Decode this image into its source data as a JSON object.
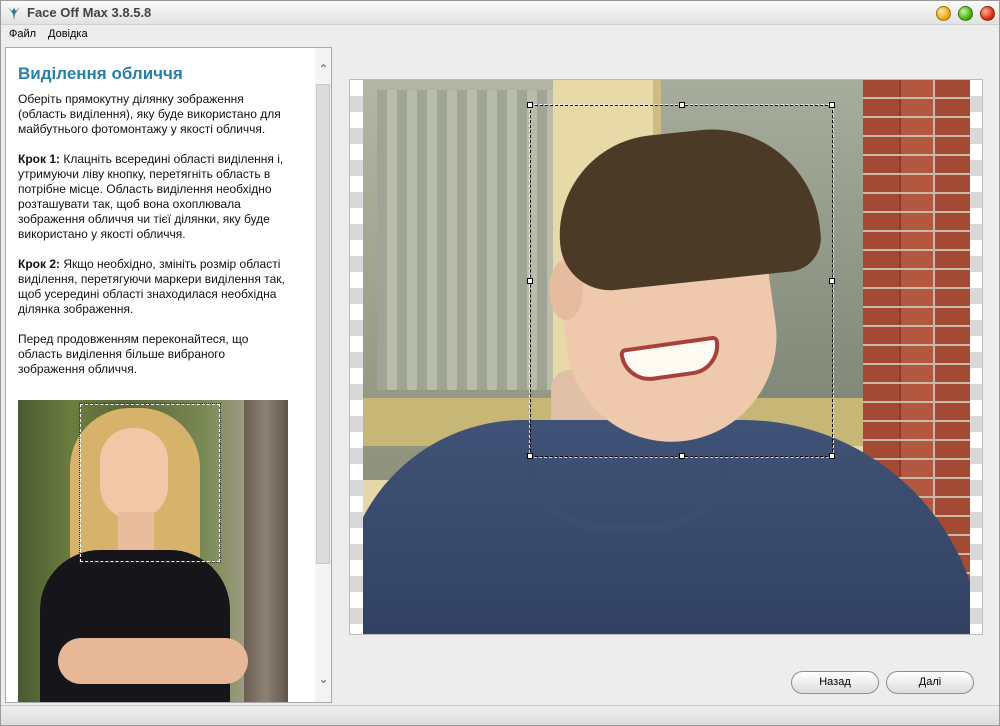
{
  "window": {
    "title": "Face Off Max  3.8.5.8"
  },
  "menu": {
    "items": [
      "Файл",
      "Довідка"
    ]
  },
  "help": {
    "title": "Виділення обличчя",
    "intro": "Оберіть прямокутну ділянку зображення (область виділення), яку буде використано для майбутнього фотомонтажу у якості обличчя.",
    "step1_label": "Крок 1:",
    "step1_text": " Клацніть всередині області виділення і, утримуючи ліву кнопку, перетягніть область в потрібне місце. Область виділення необхідно розташувати так, щоб вона охоплювала зображення обличчя чи тієї ділянки, яку буде використано у якості обличчя.",
    "step2_label": "Крок 2:",
    "step2_text": " Якщо необхідно, змініть розмір області виділення, перетягуючи маркери виділення так, щоб усередині області знаходилася необхідна ділянка зображення.",
    "outro": "Перед продовженням переконайтеся, що область виділення більше вибраного зображення обличчя."
  },
  "buttons": {
    "back": "Назад",
    "next": "Далі"
  },
  "colors": {
    "title_blue": "#2a7fa8"
  },
  "icons": {
    "app": "face-off-logo-icon",
    "scroll_up": "chevron-up-icon",
    "scroll_down": "chevron-down-icon"
  }
}
